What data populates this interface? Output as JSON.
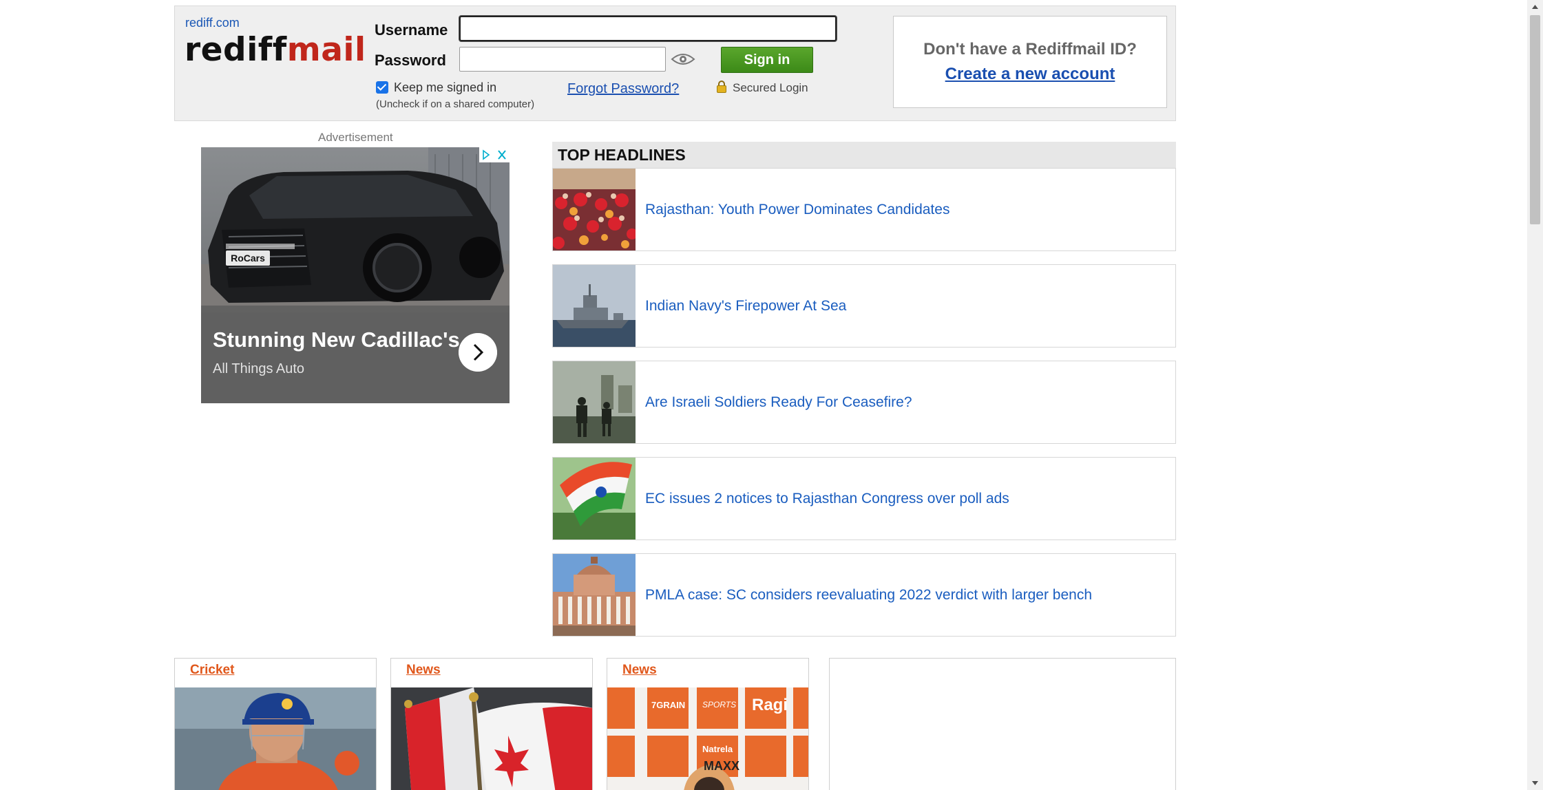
{
  "login": {
    "site_link": "rediff.com",
    "logo_part1": "rediff",
    "logo_part2": "mail",
    "username_label": "Username",
    "username_value": "",
    "password_label": "Password",
    "password_value": "",
    "signin_button": "Sign in",
    "keep_signed_label": "Keep me signed in",
    "keep_signed_checked": true,
    "keep_signed_note": "(Uncheck if on a shared computer)",
    "forgot_link": "Forgot Password?",
    "secured_label": "Secured Login",
    "signup_question": "Don't have a Rediffmail ID?",
    "signup_link": "Create a new account"
  },
  "ad": {
    "label": "Advertisement",
    "title": "Stunning New Cadillac's",
    "subtitle": "All Things Auto",
    "plate_text": "RoCars"
  },
  "headlines": {
    "title": "TOP HEADLINES",
    "items": [
      {
        "text": "Rajasthan: Youth Power Dominates Candidates"
      },
      {
        "text": "Indian Navy's Firepower At Sea"
      },
      {
        "text": "Are Israeli Soldiers Ready For Ceasefire?"
      },
      {
        "text": "EC issues 2 notices to Rajasthan Congress over poll ads"
      },
      {
        "text": "PMLA case: SC considers reevaluating 2022 verdict with larger bench"
      }
    ]
  },
  "cards": [
    {
      "category": "Cricket"
    },
    {
      "category": "News"
    },
    {
      "category": "News",
      "banner_text": [
        "7GRAIN",
        "SPORTS",
        "Ragi",
        "Natrela",
        "MAXX"
      ]
    }
  ],
  "colors": {
    "link_blue": "#1a5dbf",
    "brand_red": "#c0261b",
    "signin_green": "#4a9a22",
    "category_orange": "#e0571b"
  }
}
